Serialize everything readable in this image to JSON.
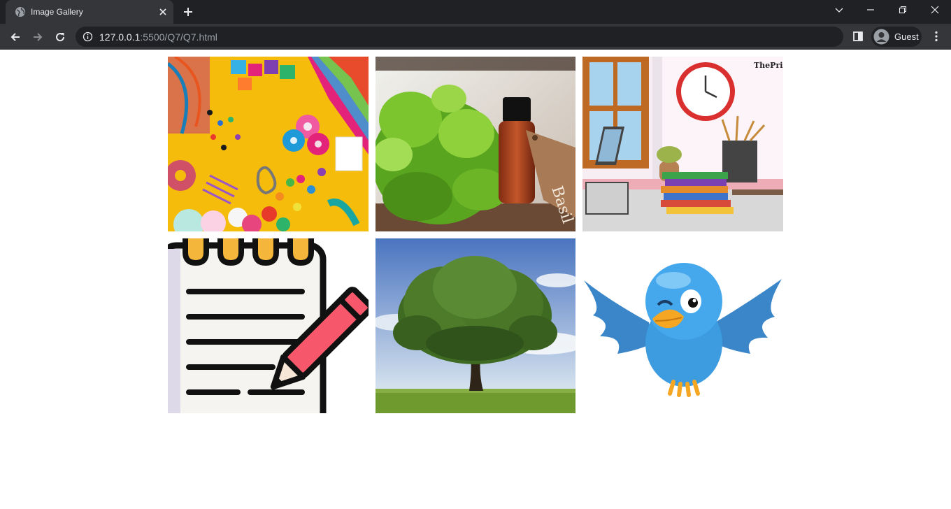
{
  "browser": {
    "tab_title": "Image Gallery",
    "url_host": "127.0.0.1",
    "url_rest": ":5500/Q7/Q7.html",
    "profile_label": "Guest"
  },
  "gallery": {
    "images": [
      {
        "subject": "craft supplies"
      },
      {
        "subject": "basil oil bottle",
        "label": "Basil"
      },
      {
        "subject": "study desk illustration",
        "watermark": "ThePrint"
      },
      {
        "subject": "notepad with pencil icon"
      },
      {
        "subject": "tree in field"
      },
      {
        "subject": "blue bird"
      }
    ]
  },
  "colors": {
    "tabbar_bg": "#202124",
    "toolbar_bg": "#35363a",
    "page_bg": "#ffffff"
  }
}
